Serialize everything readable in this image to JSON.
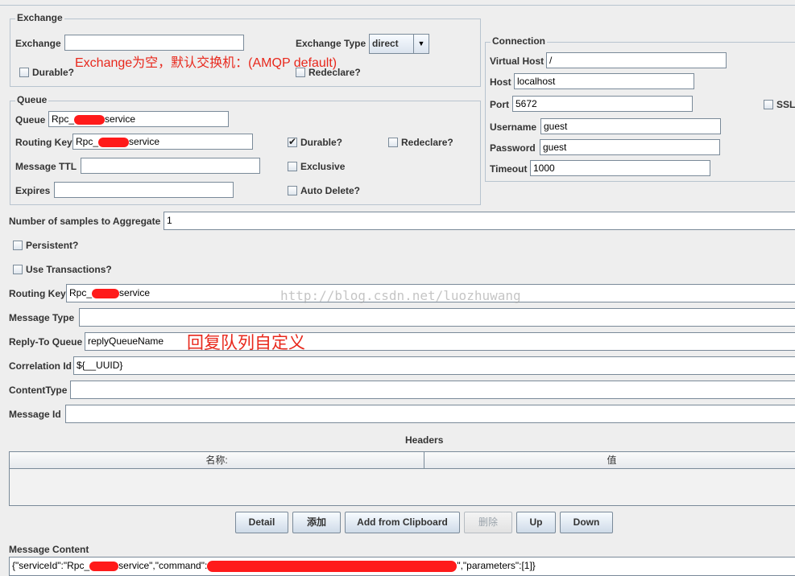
{
  "exchange": {
    "group_title": "Exchange",
    "exchange_label": "Exchange",
    "exchange_value": "",
    "type_label": "Exchange Type",
    "type_value": "direct",
    "note": "Exchange为空，默认交换机：(AMQP default)",
    "durable_label": "Durable?",
    "durable_checked": false,
    "redeclare_label": "Redeclare?",
    "redeclare_checked": false
  },
  "queue": {
    "group_title": "Queue",
    "queue_label": "Queue",
    "queue_value_prefix": "Rpc_",
    "queue_value_suffix": "service",
    "routing_label": "Routing Key",
    "routing_value_prefix": "Rpc_",
    "routing_value_suffix": "service",
    "ttl_label": "Message TTL",
    "ttl_value": "",
    "expires_label": "Expires",
    "expires_value": "",
    "durable_label": "Durable?",
    "durable_checked": true,
    "redeclare_label": "Redeclare?",
    "exclusive_label": "Exclusive",
    "autodelete_label": "Auto Delete?"
  },
  "connection": {
    "group_title": "Connection",
    "vhost_label": "Virtual Host",
    "vhost_value": "/",
    "host_label": "Host",
    "host_value": "localhost",
    "port_label": "Port",
    "port_value": "5672",
    "ssl_label": "SSL",
    "username_label": "Username",
    "username_value": "guest",
    "password_label": "Password",
    "password_value": "guest",
    "timeout_label": "Timeout",
    "timeout_value": "1000"
  },
  "main": {
    "samples_label": "Number of samples to Aggregate",
    "samples_value": "1",
    "persistent_label": "Persistent?",
    "transactions_label": "Use Transactions?",
    "routing_label": "Routing Key",
    "routing_value_prefix": "Rpc_",
    "routing_value_suffix": "service",
    "message_type_label": "Message Type",
    "message_type_value": "",
    "reply_to_label": "Reply-To Queue",
    "reply_to_value": "replyQueueName",
    "reply_note": "回复队列自定义",
    "correlation_label": "Correlation Id",
    "correlation_value": "${__UUID}",
    "content_type_label": "ContentType",
    "content_type_value": "",
    "message_id_label": "Message Id",
    "message_id_value": ""
  },
  "watermark": "http://blog.csdn.net/luozhuwang",
  "headers": {
    "title": "Headers",
    "columns": [
      "名称:",
      "值"
    ]
  },
  "buttons": {
    "detail": "Detail",
    "add": "添加",
    "add_clipboard": "Add from Clipboard",
    "delete": "删除",
    "up": "Up",
    "down": "Down"
  },
  "message_content": {
    "label": "Message Content",
    "part1": "{\"serviceId\":\"Rpc_",
    "part2": "service\",\"command\":",
    "part3": "\",\"parameters\":[1]}"
  },
  "colors": {
    "annotation": "#e8281c",
    "redaction": "#ff1a1a"
  }
}
